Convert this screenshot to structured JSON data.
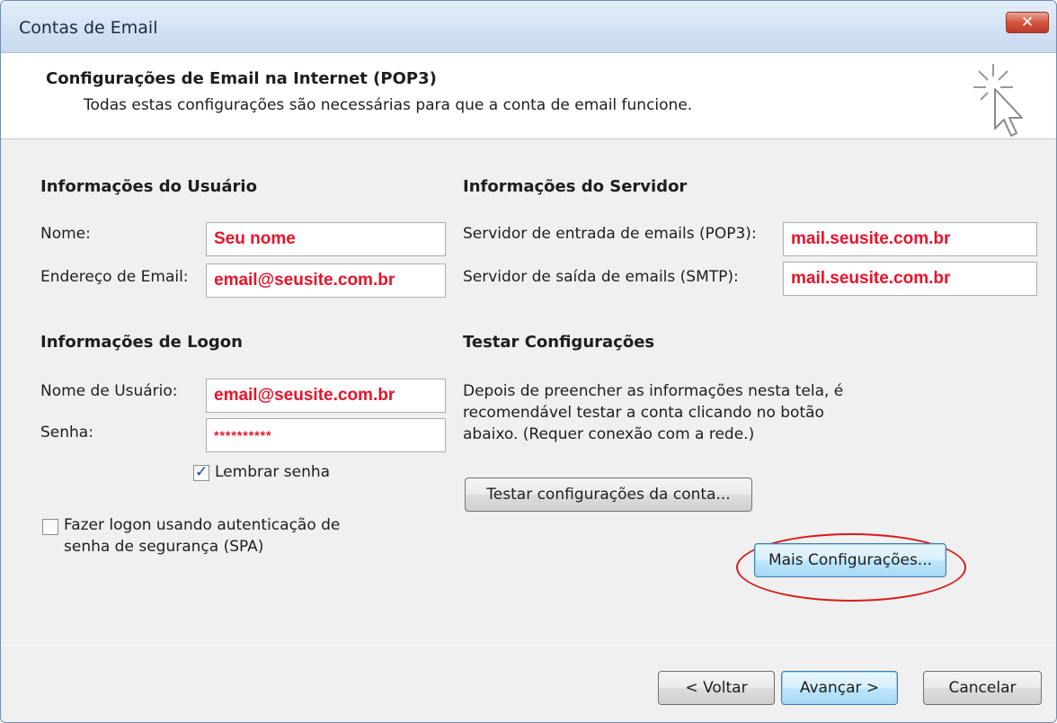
{
  "window": {
    "title": "Contas de Email",
    "close_glyph": "✕"
  },
  "header": {
    "title": "Configurações de Email na Internet (POP3)",
    "subtitle": "Todas estas configurações são necessárias para que a conta de email funcione.",
    "icon": "cursor-sparkle-icon"
  },
  "user_info": {
    "heading": "Informações do Usuário",
    "name_label": "Nome:",
    "name_value": "Seu nome",
    "email_label": "Endereço de Email:",
    "email_value": "email@seusite.com.br"
  },
  "logon_info": {
    "heading": "Informações de Logon",
    "username_label": "Nome de Usuário:",
    "username_value": "email@seusite.com.br",
    "password_label": "Senha:",
    "password_value": "**********",
    "remember_label": "Lembrar senha",
    "remember_checked": true,
    "spa_label_line1": "Fazer logon usando autenticação de",
    "spa_label_line2": "senha de segurança (SPA)",
    "spa_checked": false
  },
  "server_info": {
    "heading": "Informações do Servidor",
    "incoming_label": "Servidor de entrada de emails (POP3):",
    "incoming_value": "mail.seusite.com.br",
    "outgoing_label": "Servidor de saída de emails (SMTP):",
    "outgoing_value": "mail.seusite.com.br"
  },
  "test_settings": {
    "heading": "Testar Configurações",
    "description_line1": "Depois de preencher as informações nesta tela, é",
    "description_line2": "recomendável testar a conta clicando no botão",
    "description_line3": "abaixo. (Requer conexão com a rede.)",
    "test_button": "Testar configurações da conta...",
    "more_button": "Mais Configurações..."
  },
  "footer": {
    "back": "< Voltar",
    "next": "Avançar >",
    "cancel": "Cancelar"
  },
  "colors": {
    "highlight_red": "#d81a1a",
    "value_red": "#e8132a"
  }
}
